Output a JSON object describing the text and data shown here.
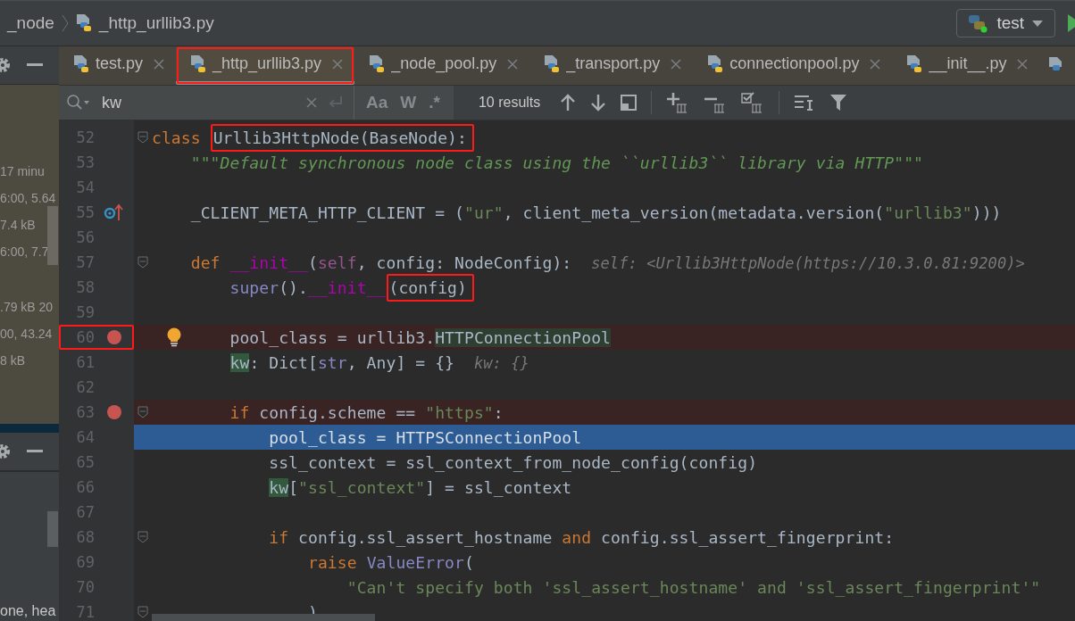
{
  "breadcrumb": [
    {
      "label": "_node",
      "kind": "folder"
    },
    {
      "label": "_http_urllib3.py",
      "kind": "file"
    }
  ],
  "run_config": {
    "label": "test"
  },
  "side_panel": {
    "groups": [
      [
        "17 minu",
        "6:00, 5.64",
        "7.4 kB",
        "6:00, 7.7"
      ],
      [
        ".79 kB 20",
        "00, 43.24",
        "8 kB"
      ]
    ],
    "footer": "one, hea"
  },
  "tabs": [
    {
      "label": "test.py",
      "selected": false,
      "annotated": false
    },
    {
      "label": "_http_urllib3.py",
      "selected": true,
      "annotated": true
    },
    {
      "label": "_node_pool.py",
      "selected": false,
      "annotated": false
    },
    {
      "label": "_transport.py",
      "selected": false,
      "annotated": false
    },
    {
      "label": "connectionpool.py",
      "selected": false,
      "annotated": false
    },
    {
      "label": "__init__.py",
      "selected": false,
      "annotated": false
    }
  ],
  "search": {
    "value": "kw",
    "toggles": [
      {
        "label": "Aa",
        "selected": false
      },
      {
        "label": "W",
        "selected": false
      },
      {
        "label": ".*",
        "selected": false
      }
    ],
    "result_count": "10 results"
  },
  "editor": {
    "lines": [
      {
        "number": "52",
        "breakpoint": false,
        "execution": false,
        "override_marker": false,
        "intention": false,
        "annotated": false,
        "fold": true,
        "tokens": [
          {
            "text": "class ",
            "kind": "kw"
          },
          {
            "text": "Urllib3HttpNode(BaseNode):",
            "kind": "plain",
            "annotated": true
          }
        ]
      },
      {
        "number": "53",
        "breakpoint": false,
        "execution": false,
        "override_marker": false,
        "intention": false,
        "annotated": false,
        "fold": false,
        "tokens": [
          {
            "text": "    \"\"\"Default synchronous node class using the ``urllib3`` library via HTTP\"\"\"",
            "kind": "doc"
          }
        ]
      },
      {
        "number": "54",
        "breakpoint": false,
        "execution": false,
        "override_marker": false,
        "intention": false,
        "annotated": false,
        "fold": false
      },
      {
        "number": "55",
        "breakpoint": false,
        "execution": false,
        "override_marker": true,
        "intention": false,
        "annotated": false,
        "fold": false,
        "tokens": [
          {
            "text": "    _CLIENT_META_HTTP_CLIENT = (",
            "kind": "plain"
          },
          {
            "text": "\"ur\"",
            "kind": "str"
          },
          {
            "text": ", client_meta_version(metadata.version(",
            "kind": "plain"
          },
          {
            "text": "\"urllib3\"",
            "kind": "str"
          },
          {
            "text": ")))",
            "kind": "plain"
          }
        ]
      },
      {
        "number": "56",
        "breakpoint": false,
        "execution": false,
        "override_marker": false,
        "intention": false,
        "annotated": false,
        "fold": false
      },
      {
        "number": "57",
        "breakpoint": false,
        "execution": false,
        "override_marker": false,
        "intention": false,
        "annotated": false,
        "fold": true,
        "tokens": [
          {
            "text": "    def ",
            "kind": "kw"
          },
          {
            "text": "__init__",
            "kind": "magic"
          },
          {
            "text": "(",
            "kind": "plain"
          },
          {
            "text": "self",
            "kind": "self"
          },
          {
            "text": ", config: NodeConfig):",
            "kind": "plain"
          },
          {
            "text": "  self: <Urllib3HttpNode(https://10.3.0.81:9200)>",
            "kind": "hint"
          }
        ]
      },
      {
        "number": "58",
        "breakpoint": false,
        "execution": false,
        "override_marker": false,
        "intention": false,
        "annotated": false,
        "fold": false,
        "tokens": [
          {
            "text": "        super",
            "kind": "builtin"
          },
          {
            "text": "().",
            "kind": "plain"
          },
          {
            "text": "__init__",
            "kind": "magic"
          },
          {
            "text": "(config)",
            "kind": "plain",
            "annotated": true
          }
        ]
      },
      {
        "number": "59",
        "breakpoint": false,
        "execution": false,
        "override_marker": false,
        "intention": false,
        "annotated": false,
        "fold": false
      },
      {
        "number": "60",
        "breakpoint": true,
        "execution": false,
        "override_marker": false,
        "intention": true,
        "annotated": true,
        "fold": false,
        "tokens": [
          {
            "text": "        pool_class = urllib3.",
            "kind": "plain"
          },
          {
            "text": "HTTPConnectionPool",
            "kind": "ref"
          }
        ]
      },
      {
        "number": "61",
        "breakpoint": false,
        "execution": false,
        "override_marker": false,
        "intention": false,
        "annotated": false,
        "fold": false,
        "tokens": [
          {
            "text": "        kw",
            "kind": "match"
          },
          {
            "text": ": Dict[",
            "kind": "plain"
          },
          {
            "text": "str",
            "kind": "builtin"
          },
          {
            "text": ", Any] = {}",
            "kind": "plain"
          },
          {
            "text": "  kw: {}",
            "kind": "hint"
          }
        ]
      },
      {
        "number": "62",
        "breakpoint": false,
        "execution": false,
        "override_marker": false,
        "intention": false,
        "annotated": false,
        "fold": false
      },
      {
        "number": "63",
        "breakpoint": true,
        "execution": false,
        "override_marker": false,
        "intention": false,
        "annotated": false,
        "fold": true,
        "tokens": [
          {
            "text": "        if ",
            "kind": "kw"
          },
          {
            "text": "config.scheme == ",
            "kind": "plain"
          },
          {
            "text": "\"https\"",
            "kind": "str"
          },
          {
            "text": ":",
            "kind": "plain"
          }
        ]
      },
      {
        "number": "64",
        "breakpoint": false,
        "execution": true,
        "override_marker": false,
        "intention": false,
        "annotated": false,
        "fold": false,
        "tokens": [
          {
            "text": "            pool_class = HTTPSConnectionPool",
            "kind": "plain"
          }
        ]
      },
      {
        "number": "65",
        "breakpoint": false,
        "execution": false,
        "override_marker": false,
        "intention": false,
        "annotated": false,
        "fold": false,
        "tokens": [
          {
            "text": "            ssl_context = ssl_context_from_node_config(config)",
            "kind": "plain"
          }
        ]
      },
      {
        "number": "66",
        "breakpoint": false,
        "execution": false,
        "override_marker": false,
        "intention": false,
        "annotated": false,
        "fold": false,
        "tokens": [
          {
            "text": "            kw",
            "kind": "match"
          },
          {
            "text": "[",
            "kind": "plain"
          },
          {
            "text": "\"ssl_context\"",
            "kind": "str"
          },
          {
            "text": "] = ssl_context",
            "kind": "plain"
          }
        ]
      },
      {
        "number": "67",
        "breakpoint": false,
        "execution": false,
        "override_marker": false,
        "intention": false,
        "annotated": false,
        "fold": false
      },
      {
        "number": "68",
        "breakpoint": false,
        "execution": false,
        "override_marker": false,
        "intention": false,
        "annotated": false,
        "fold": true,
        "tokens": [
          {
            "text": "            if ",
            "kind": "kw"
          },
          {
            "text": "config.ssl_assert_hostname ",
            "kind": "plain"
          },
          {
            "text": "and",
            "kind": "kw"
          },
          {
            "text": " config.ssl_assert_fingerprint:",
            "kind": "plain"
          }
        ]
      },
      {
        "number": "69",
        "breakpoint": false,
        "execution": false,
        "override_marker": false,
        "intention": false,
        "annotated": false,
        "fold": false,
        "tokens": [
          {
            "text": "                raise ",
            "kind": "kw"
          },
          {
            "text": "ValueError",
            "kind": "builtin"
          },
          {
            "text": "(",
            "kind": "plain"
          }
        ]
      },
      {
        "number": "70",
        "breakpoint": false,
        "execution": false,
        "override_marker": false,
        "intention": false,
        "annotated": false,
        "fold": false,
        "tokens": [
          {
            "text": "                    \"Can't specify both 'ssl_assert_hostname' and 'ssl_assert_fingerprint'\"",
            "kind": "str"
          }
        ]
      },
      {
        "number": "71",
        "breakpoint": false,
        "execution": false,
        "override_marker": false,
        "intention": false,
        "annotated": false,
        "fold": true,
        "tokens": [
          {
            "text": "                )",
            "kind": "plain"
          }
        ]
      }
    ]
  }
}
